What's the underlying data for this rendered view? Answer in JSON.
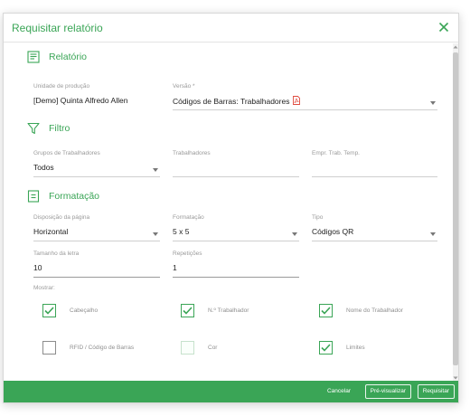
{
  "dialog": {
    "title": "Requisitar relatório"
  },
  "colors": {
    "accent": "#3aa556",
    "footer_bg": "#3aa556",
    "pdf": "#e04b3f"
  },
  "sections": {
    "relatorio": {
      "title": "Relatório",
      "icon": "report-icon"
    },
    "filtro": {
      "title": "Filtro",
      "icon": "filter-icon"
    },
    "formatacao": {
      "title": "Formatação",
      "icon": "document-icon"
    }
  },
  "fields": {
    "unidade": {
      "label": "Unidade de produção",
      "value": "[Demo] Quinta Alfredo Allen"
    },
    "versao": {
      "label": "Versão *",
      "value": "Códigos de Barras: Trabalhadores"
    },
    "grupos": {
      "label": "Grupos de Trabalhadores",
      "value": "Todos"
    },
    "trabalhadores": {
      "label": "Trabalhadores",
      "value": ""
    },
    "empr": {
      "label": "Empr. Trab. Temp.",
      "value": ""
    },
    "disposicao": {
      "label": "Disposição da página",
      "value": "Horizontal"
    },
    "formatacao": {
      "label": "Formatação",
      "value": "5 x 5"
    },
    "tipo": {
      "label": "Tipo",
      "value": "Códigos QR"
    },
    "tamanho": {
      "label": "Tamanho da letra",
      "value": "10"
    },
    "repeticoes": {
      "label": "Repetições",
      "value": "1"
    }
  },
  "mostrar": {
    "label": "Mostrar:",
    "options": [
      {
        "label": "Cabeçalho",
        "checked": true
      },
      {
        "label": "N.º Trabalhador",
        "checked": true
      },
      {
        "label": "Nome do Trabalhador",
        "checked": true
      },
      {
        "label": "RFID / Código de Barras",
        "checked": false
      },
      {
        "label": "Cor",
        "checked": false
      },
      {
        "label": "Limites",
        "checked": true
      }
    ]
  },
  "footer": {
    "cancel_label": "Cancelar",
    "preview_label": "Pré-visualizar",
    "request_label": "Requisitar"
  }
}
